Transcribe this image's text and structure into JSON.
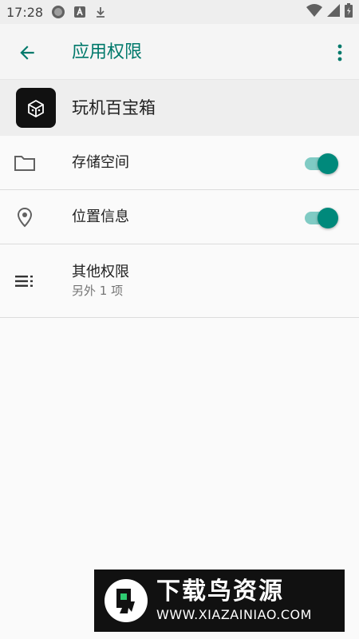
{
  "status_bar": {
    "time": "17:28",
    "icons": [
      "record-icon",
      "font-a-icon",
      "download-icon",
      "wifi-icon",
      "cellular-icon",
      "battery-icon"
    ]
  },
  "app_bar": {
    "title": "应用权限",
    "back_icon": "arrow-back-icon",
    "overflow_icon": "more-vert-icon"
  },
  "app": {
    "name": "玩机百宝箱",
    "icon": "box-icon"
  },
  "permissions": [
    {
      "label": "存储空间",
      "icon": "folder-icon",
      "enabled": true
    },
    {
      "label": "位置信息",
      "icon": "location-pin-icon",
      "enabled": true
    },
    {
      "label": "其他权限",
      "sublabel": "另外 1 项",
      "icon": "list-icon"
    }
  ],
  "watermark": {
    "title": "下载鸟资源",
    "url": "WWW.XIAZAINIAO.COM"
  },
  "colors": {
    "accent": "#00796b",
    "switch_thumb": "#00897b",
    "switch_track": "#80cbc4"
  }
}
